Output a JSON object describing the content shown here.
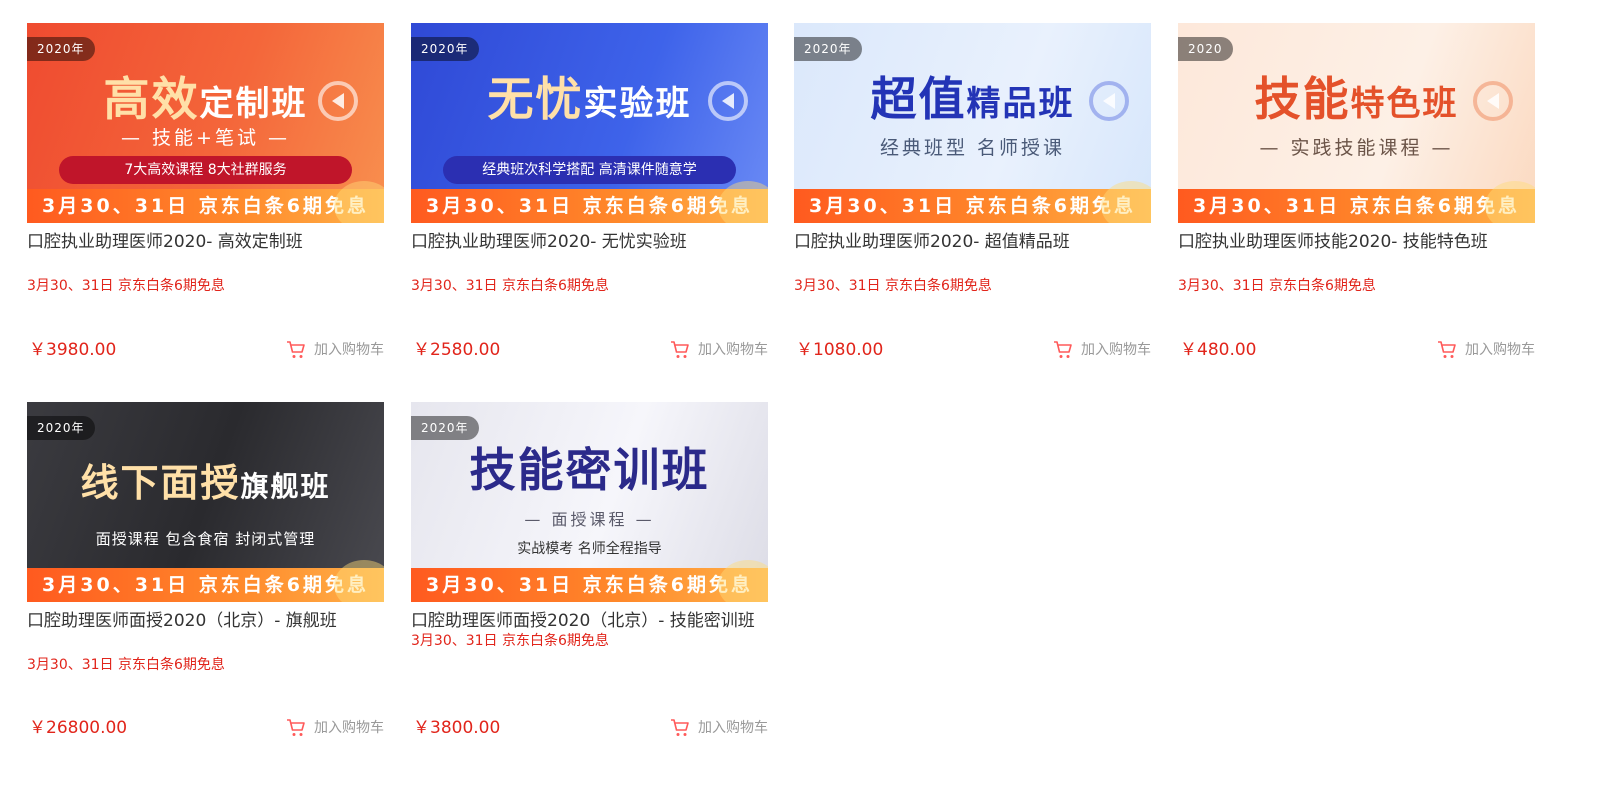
{
  "products": [
    {
      "banner": {
        "year": "2020年",
        "headline_big": "高效",
        "headline_small": "定制班",
        "sub": "— 技能+笔试 —",
        "pill": "7大高效课程  8大社群服务",
        "promo": "3月30、31日  京东白条6期免息"
      },
      "title": "口腔执业助理医师2020- 高效定制班",
      "promo_text": "3月30、31日 京东白条6期免息",
      "price": "￥3980.00",
      "cart_label": "加入购物车"
    },
    {
      "banner": {
        "year": "2020年",
        "headline_big": "无忧",
        "headline_small": "实验班",
        "sub": "",
        "pill": "经典班次科学搭配 高清课件随意学",
        "promo": "3月30、31日  京东白条6期免息"
      },
      "title": "口腔执业助理医师2020- 无忧实验班",
      "promo_text": "3月30、31日 京东白条6期免息",
      "price": "￥2580.00",
      "cart_label": "加入购物车"
    },
    {
      "banner": {
        "year": "2020年",
        "headline_big": "超值",
        "headline_small": "精品班",
        "sub": "经典班型   名师授课",
        "pill": "",
        "promo": "3月30、31日  京东白条6期免息"
      },
      "title": "口腔执业助理医师2020- 超值精品班",
      "promo_text": "3月30、31日 京东白条6期免息",
      "price": "￥1080.00",
      "cart_label": "加入购物车"
    },
    {
      "banner": {
        "year": "2020",
        "headline_big": "技能",
        "headline_small": "特色班",
        "sub": "— 实践技能课程 —",
        "pill": "",
        "promo": "3月30、31日  京东白条6期免息"
      },
      "title": "口腔执业助理医师技能2020- 技能特色班",
      "promo_text": "3月30、31日 京东白条6期免息",
      "price": "￥480.00",
      "cart_label": "加入购物车"
    },
    {
      "banner": {
        "year": "2020年",
        "headline_big": "线下面授",
        "headline_small": "旗舰班",
        "sub": "面授课程 包含食宿 封闭式管理",
        "pill": "",
        "promo": "3月30、31日  京东白条6期免息"
      },
      "title": "口腔助理医师面授2020（北京）- 旗舰班",
      "promo_text": "3月30、31日 京东白条6期免息",
      "price": "￥26800.00",
      "cart_label": "加入购物车"
    },
    {
      "banner": {
        "year": "2020年",
        "headline_big": "技能密训班",
        "headline_small": "",
        "sub": "— 面授课程 —",
        "sub2": "实战模考 名师全程指导",
        "pill": "",
        "promo": "3月30、31日  京东白条6期免息"
      },
      "title": "口腔助理医师面授2020（北京）- 技能密训班",
      "promo_text": "3月30、31日 京东白条6期免息",
      "price": "￥3800.00",
      "cart_label": "加入购物车"
    }
  ],
  "colors": {
    "price_red": "#e1251b",
    "title_text": "#333333",
    "cart_text": "#999999"
  }
}
